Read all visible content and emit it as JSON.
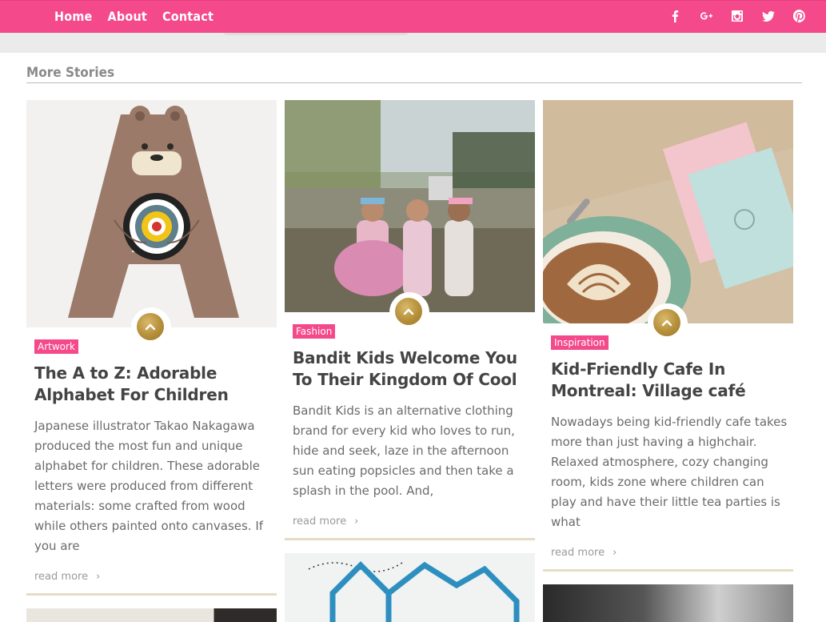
{
  "nav": {
    "items": [
      "Home",
      "About",
      "Contact"
    ]
  },
  "social": [
    "facebook-icon",
    "google-plus-icon",
    "instagram-icon",
    "twitter-icon",
    "pinterest-icon"
  ],
  "colors": {
    "accent": "#f4498a",
    "gold": "#b58f3a",
    "rule": "#e4dcc4"
  },
  "section": {
    "title": "More Stories"
  },
  "cards": [
    {
      "tag": "Artwork",
      "title": "The A to Z: Adorable Alphabet For Children",
      "excerpt": "Japanese illustrator Takao Nakagawa produced the most fun and unique alphabet for children. These adorable letters were produced from different materials: some crafted from wood while others painted onto canvases. If you are",
      "read_more": "read more"
    },
    {
      "tag": "Fashion",
      "title": "Bandit Kids Welcome You To Their Kingdom Of Cool",
      "excerpt": "Bandit Kids is an alternative clothing brand for every kid who loves to run, hide and seek, laze in the afternoon sun eating popsicles and then take a splash in the pool. And,",
      "read_more": "read more"
    },
    {
      "tag": "Inspiration",
      "title": "Kid-Friendly Cafe In Montreal: Village café",
      "excerpt": "Nowadays being kid-friendly cafe takes more than just having a highchair. Relaxed atmosphere, cozy changing room, kids zone where children can play and have their little tea parties is what",
      "read_more": "read more"
    }
  ]
}
